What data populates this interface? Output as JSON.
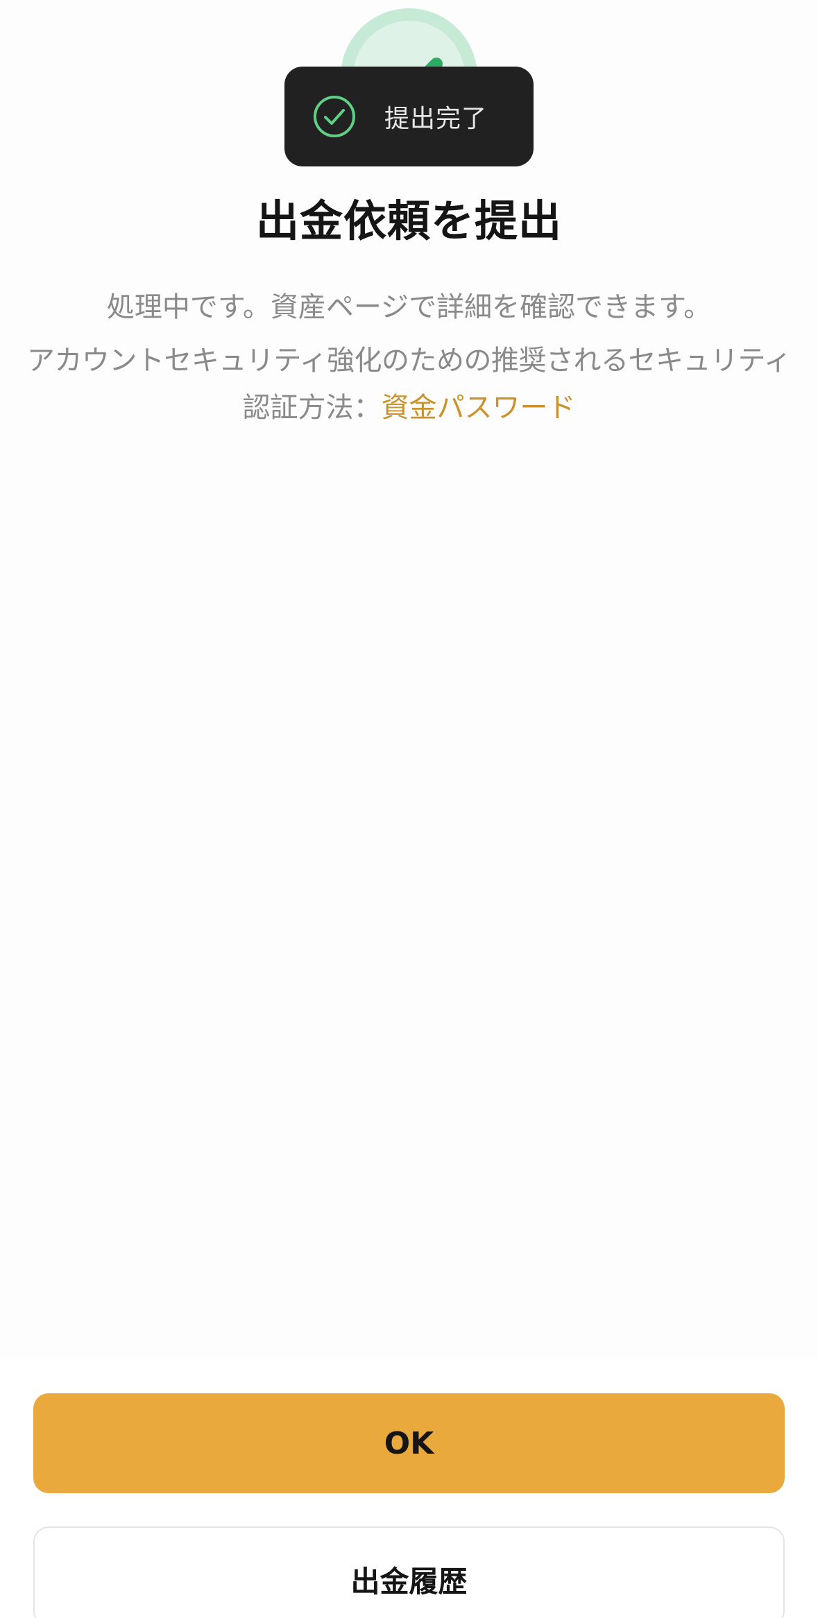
{
  "toast": {
    "icon": "check-circle-icon",
    "text": "提出完了"
  },
  "success_icon": "check-mark-icon",
  "title": "出金依頼を提出",
  "description": {
    "line1": "処理中です。資産ページで詳細を確認できます。",
    "line2": "アカウントセキュリティ強化のための推奨されるセキュリティ",
    "line3_prefix": "認証方法：",
    "line3_link": "資金パスワード"
  },
  "buttons": {
    "ok_label": "OK",
    "history_label": "出金履歴"
  },
  "colors": {
    "primary": "#eaa93c",
    "link": "#c9922e",
    "success": "#5fcf84",
    "toast_bg": "#212121"
  }
}
